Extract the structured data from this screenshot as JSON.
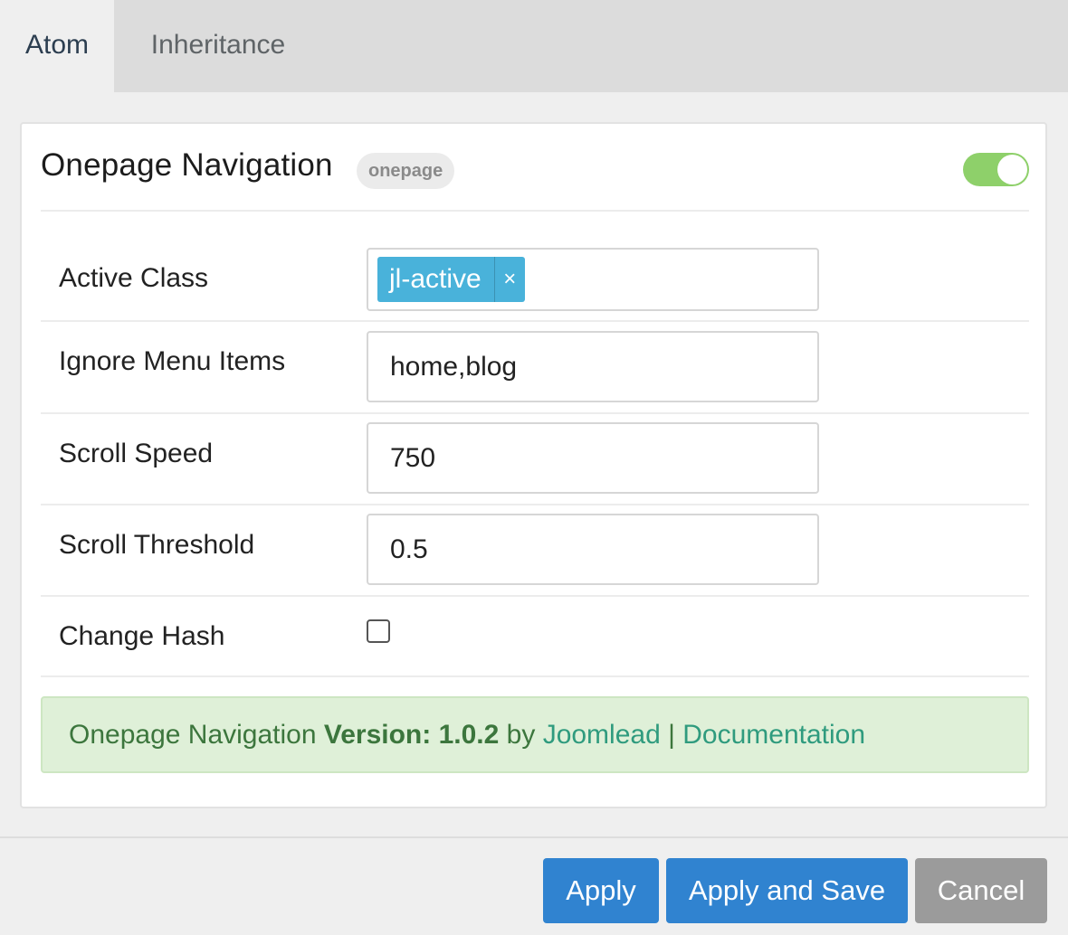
{
  "tabs": [
    {
      "label": "Atom",
      "active": true
    },
    {
      "label": "Inheritance",
      "active": false
    }
  ],
  "card": {
    "title": "Onepage Navigation",
    "badge": "onepage",
    "enabled": true
  },
  "fields": {
    "active_class": {
      "label": "Active Class",
      "tag": "jl-active",
      "tag_remove": "×"
    },
    "ignore_menu_items": {
      "label": "Ignore Menu Items",
      "value": "home,blog"
    },
    "scroll_speed": {
      "label": "Scroll Speed",
      "value": "750"
    },
    "scroll_threshold": {
      "label": "Scroll Threshold",
      "value": "0.5"
    },
    "change_hash": {
      "label": "Change Hash",
      "checked": false
    }
  },
  "info": {
    "name": "Onepage Navigation",
    "version_label": "Version: 1.0.2",
    "by": "by",
    "author": "Joomlead",
    "separator": "|",
    "docs": "Documentation"
  },
  "buttons": {
    "apply": "Apply",
    "apply_save": "Apply and Save",
    "cancel": "Cancel"
  },
  "colors": {
    "primary": "#3083d0",
    "toggle_on": "#8ed06a",
    "tag": "#49b2da",
    "success_bg": "#dff0d8"
  }
}
